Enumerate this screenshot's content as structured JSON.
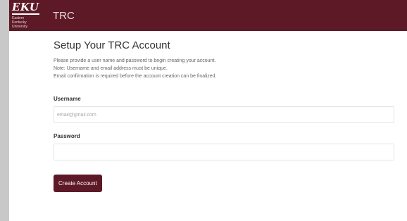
{
  "navbar": {
    "logo_text": "EKU",
    "logo_subtext": "Eastern Kentucky University",
    "brand": "TRC",
    "background_color": "#5d1a26"
  },
  "form": {
    "title": "Setup Your TRC Account",
    "info_lines": [
      "Please provide a user name and password to begin creating your account.",
      "Note: Username and email address must be unique.",
      "Email confirmation is required before the account creation can be finalized."
    ],
    "username_label": "Username",
    "username_placeholder": "email@gmail.com",
    "username_value": "",
    "password_label": "Password",
    "password_placeholder": "",
    "password_value": "",
    "submit_label": "Create Account",
    "button_color": "#5d1a26"
  }
}
